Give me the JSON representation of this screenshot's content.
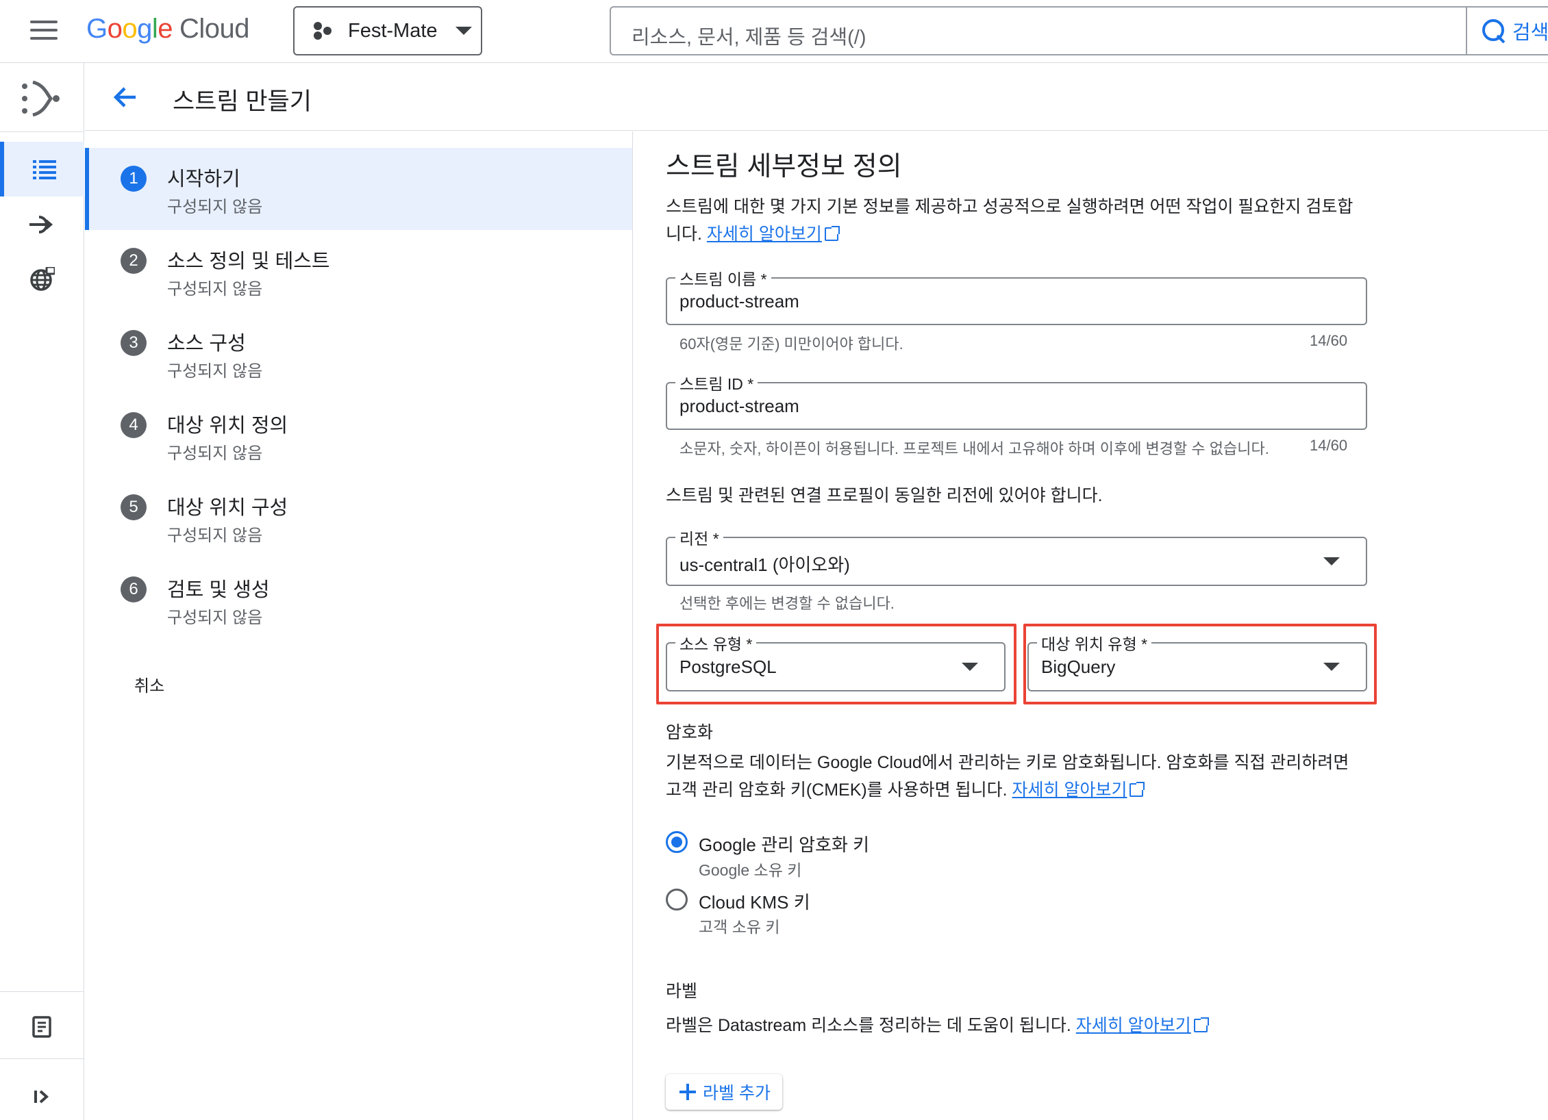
{
  "topbar": {
    "logo_letters": [
      "G",
      "o",
      "o",
      "g",
      "l",
      "e"
    ],
    "logo_colors": [
      "#4285F4",
      "#EA4335",
      "#FBBC05",
      "#4285F4",
      "#34A853",
      "#EA4335"
    ],
    "logo_cloud": "Cloud",
    "project": "Fest-Mate",
    "search_placeholder": "리소스, 문서, 제품 등 검색(/)",
    "search_button": "검색"
  },
  "rail": {
    "icons": [
      "datastream-product-icon",
      "list-icon",
      "connection-icon",
      "globe-icon",
      "release-notes-icon",
      "expand-icon"
    ]
  },
  "header": {
    "title": "스트림 만들기"
  },
  "steps": [
    {
      "num": "1",
      "title": "시작하기",
      "status": "구성되지 않음"
    },
    {
      "num": "2",
      "title": "소스 정의 및 테스트",
      "status": "구성되지 않음"
    },
    {
      "num": "3",
      "title": "소스 구성",
      "status": "구성되지 않음"
    },
    {
      "num": "4",
      "title": "대상 위치 정의",
      "status": "구성되지 않음"
    },
    {
      "num": "5",
      "title": "대상 위치 구성",
      "status": "구성되지 않음"
    },
    {
      "num": "6",
      "title": "검토 및 생성",
      "status": "구성되지 않음"
    }
  ],
  "cancel": "취소",
  "form": {
    "title": "스트림 세부정보 정의",
    "desc": "스트림에 대한 몇 가지 기본 정보를 제공하고 성공적으로 실행하려면 어떤 작업이 필요한지 검토합니다.",
    "desc_link": "자세히 알아보기",
    "stream_name": {
      "label": "스트림 이름 *",
      "value": "product-stream",
      "hint": "60자(영문 기준) 미만이어야 합니다.",
      "counter": "14/60"
    },
    "stream_id": {
      "label": "스트림 ID *",
      "value": "product-stream",
      "hint": "소문자, 숫자, 하이픈이 허용됩니다. 프로젝트 내에서 고유해야 하며 이후에 변경할 수 없습니다.",
      "counter": "14/60"
    },
    "region_note": "스트림 및 관련된 연결 프로필이 동일한 리전에 있어야 합니다.",
    "region": {
      "label": "리전 *",
      "value": "us-central1 (아이오와)",
      "hint": "선택한 후에는 변경할 수 없습니다."
    },
    "source_type": {
      "label": "소스 유형 *",
      "value": "PostgreSQL"
    },
    "dest_type": {
      "label": "대상 위치 유형 *",
      "value": "BigQuery"
    },
    "encryption": {
      "title": "암호화",
      "desc": "기본적으로 데이터는 Google Cloud에서 관리하는 키로 암호화됩니다. 암호화를 직접 관리하려면 고객 관리 암호화 키(CMEK)를 사용하면 됩니다.",
      "desc_link": "자세히 알아보기",
      "options": [
        {
          "label": "Google 관리 암호화 키",
          "sub": "Google 소유 키",
          "checked": true
        },
        {
          "label": "Cloud KMS 키",
          "sub": "고객 소유 키",
          "checked": false
        }
      ]
    },
    "labels": {
      "title": "라벨",
      "desc": "라벨은 Datastream 리소스를 정리하는 데 도움이 됩니다.",
      "desc_link": "자세히 알아보기",
      "add_button": "라벨 추가"
    }
  },
  "colors": {
    "accent": "#1a73e8",
    "highlight": "#ea4335",
    "active_bg": "#e8f0fe"
  }
}
